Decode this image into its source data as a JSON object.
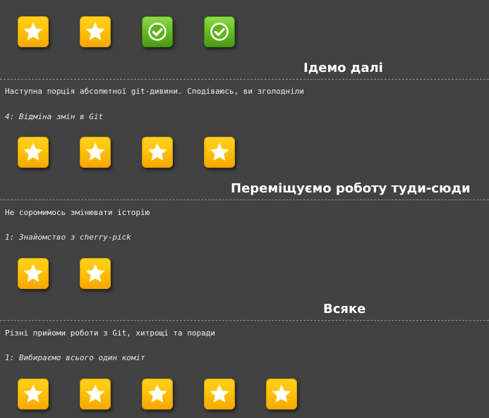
{
  "colors": {
    "background": "#424242",
    "star_tile": "#ffc20a",
    "done_tile": "#66bb22",
    "divider": "#8c8c8c"
  },
  "top_row": {
    "levels": [
      {
        "status": "pending",
        "icon": "star-icon"
      },
      {
        "status": "pending",
        "icon": "star-icon"
      },
      {
        "status": "done",
        "icon": "checkmark-icon"
      },
      {
        "status": "done",
        "icon": "checkmark-icon"
      }
    ]
  },
  "sequences": [
    {
      "title": "Ідемо далі",
      "description": "Наступна порція абсолютної git-дивини. Сподіваюсь, ви зголодніли",
      "current_level": "4: Відміна змін в Git",
      "levels": [
        {
          "status": "pending",
          "icon": "star-icon"
        },
        {
          "status": "pending",
          "icon": "star-icon"
        },
        {
          "status": "pending",
          "icon": "star-icon"
        },
        {
          "status": "pending",
          "icon": "star-icon"
        }
      ]
    },
    {
      "title": "Переміщуємо роботу туди-сюди",
      "description": "Не соромимось змінювати історію",
      "current_level": "1: Знайомство з cherry-pick",
      "levels": [
        {
          "status": "pending",
          "icon": "star-icon"
        },
        {
          "status": "pending",
          "icon": "star-icon"
        }
      ]
    },
    {
      "title": "Всяке",
      "description": "Різні прийоми роботи з Git, хитрощі та поради",
      "current_level": "1: Вибираємо всього один коміт",
      "levels": [
        {
          "status": "pending",
          "icon": "star-icon"
        },
        {
          "status": "pending",
          "icon": "star-icon"
        },
        {
          "status": "pending",
          "icon": "star-icon"
        },
        {
          "status": "pending",
          "icon": "star-icon"
        },
        {
          "status": "pending",
          "icon": "star-icon"
        }
      ]
    }
  ]
}
